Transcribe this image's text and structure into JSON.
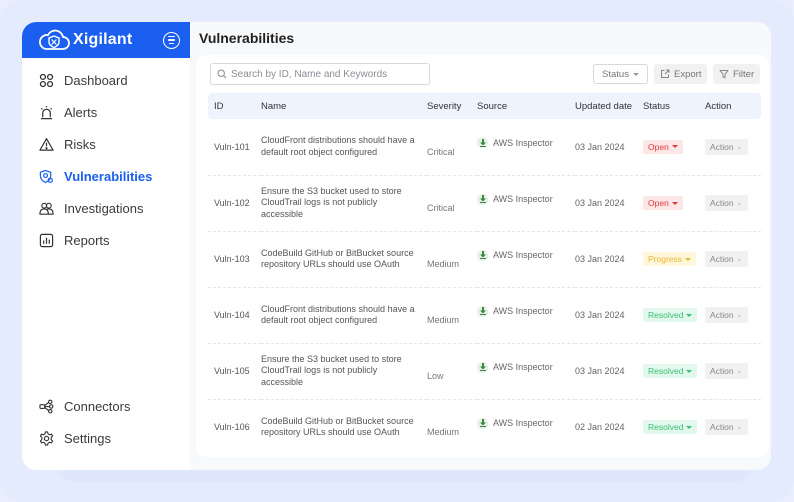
{
  "app": {
    "name": "Xigilant",
    "accent": "#1a5ff0"
  },
  "sidebar": {
    "items": [
      {
        "label": "Dashboard",
        "icon": "dashboard-grid-icon"
      },
      {
        "label": "Alerts",
        "icon": "siren-icon"
      },
      {
        "label": "Risks",
        "icon": "warning-triangle-icon"
      },
      {
        "label": "Vulnerabilities",
        "icon": "shield-bug-icon",
        "active": true
      },
      {
        "label": "Investigations",
        "icon": "users-icon"
      },
      {
        "label": "Reports",
        "icon": "bar-report-icon"
      }
    ],
    "bottom_items": [
      {
        "label": "Connectors",
        "icon": "connectors-icon"
      },
      {
        "label": "Settings",
        "icon": "gear-icon"
      }
    ]
  },
  "main": {
    "title": "Vulnerabilities",
    "search": {
      "placeholder": "Search by ID, Name and Keywords",
      "value": ""
    },
    "toolbar": {
      "status_label": "Status",
      "export_label": "Export",
      "filter_label": "Filter"
    },
    "table": {
      "columns": [
        "ID",
        "Name",
        "Severity",
        "Source",
        "Updated date",
        "Status",
        "Action"
      ],
      "rows": [
        {
          "id": "Vuln-101",
          "name": "CloudFront distributions should have a default root object configured",
          "severity": "Critical",
          "source": "AWS Inspector",
          "date": "03 Jan 2024",
          "status": "Open",
          "status_type": "open",
          "action": "Action"
        },
        {
          "id": "Vuln-102",
          "name": "Ensure the S3 bucket used to store CloudTrail logs is not publicly accessible",
          "severity": "Critical",
          "source": "AWS Inspector",
          "date": "03 Jan 2024",
          "status": "Open",
          "status_type": "open",
          "action": "Action"
        },
        {
          "id": "Vuln-103",
          "name": "CodeBuild GitHub or BitBucket source repository URLs should use OAuth",
          "severity": "Medium",
          "source": "AWS Inspector",
          "date": "03 Jan 2024",
          "status": "Progress",
          "status_type": "progress",
          "action": "Action"
        },
        {
          "id": "Vuln-104",
          "name": "CloudFront distributions should have a default root object configured",
          "severity": "Medium",
          "source": "AWS Inspector",
          "date": "03 Jan 2024",
          "status": "Resolved",
          "status_type": "resolved",
          "action": "Action"
        },
        {
          "id": "Vuln-105",
          "name": "Ensure the S3 bucket used to store CloudTrail logs is not publicly accessible",
          "severity": "Low",
          "source": "AWS Inspector",
          "date": "03 Jan 2024",
          "status": "Resolved",
          "status_type": "resolved",
          "action": "Action"
        },
        {
          "id": "Vuln-106",
          "name": "CodeBuild GitHub or BitBucket source repository URLs should use OAuth",
          "severity": "Medium",
          "source": "AWS Inspector",
          "date": "02 Jan 2024",
          "status": "Resolved",
          "status_type": "resolved",
          "action": "Action"
        }
      ]
    }
  },
  "colors": {
    "open": "#e0383e",
    "progress": "#e8b92b",
    "resolved": "#3ac07a"
  }
}
